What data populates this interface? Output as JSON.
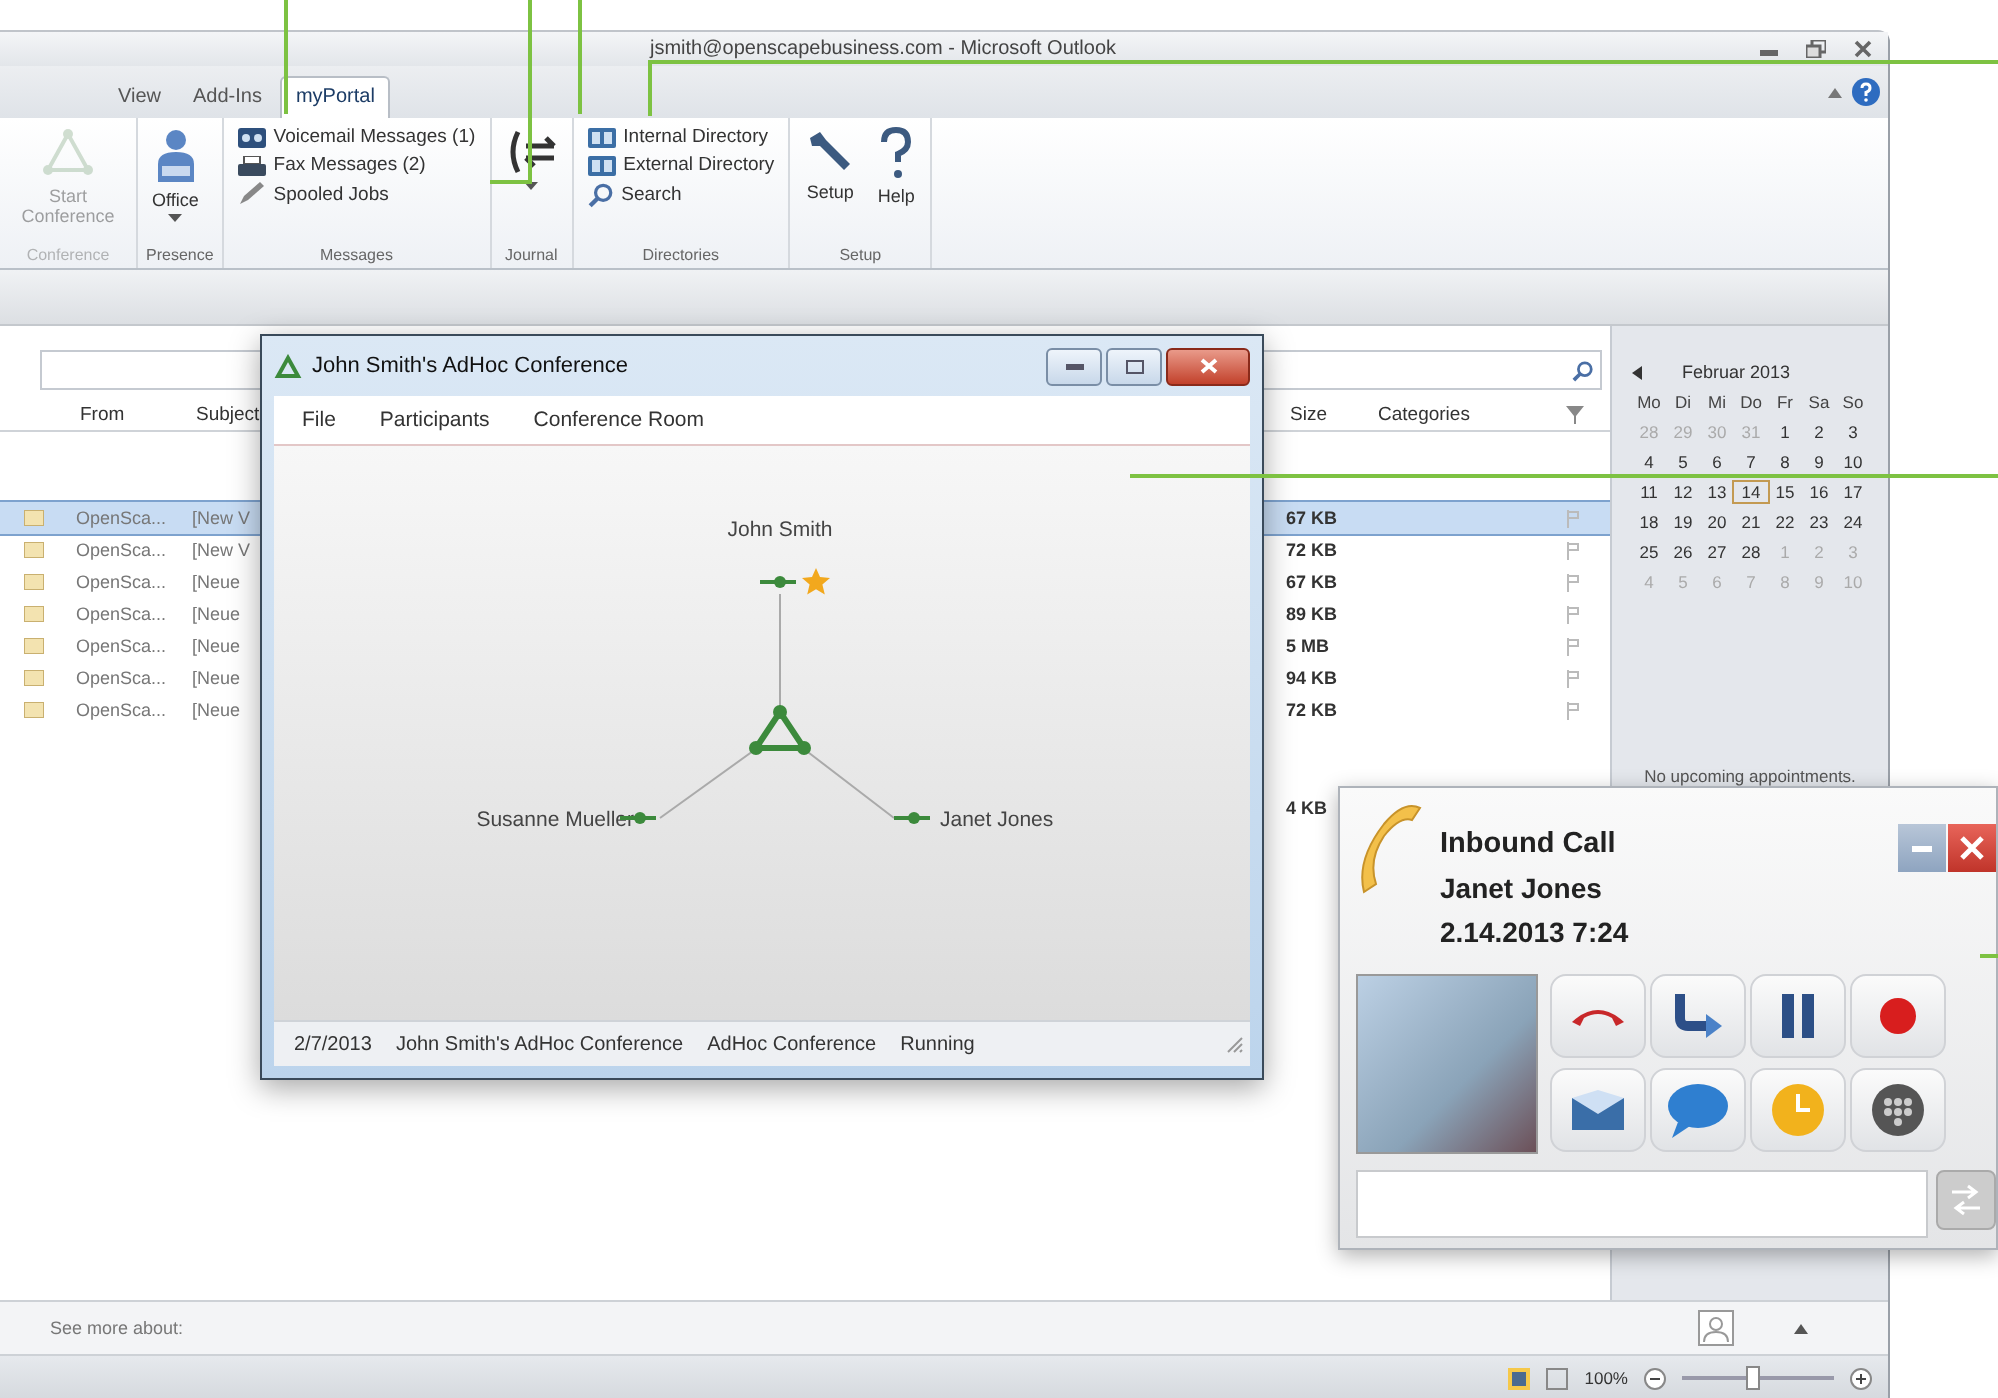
{
  "outlook": {
    "title": "jsmith@openscapebusiness.com - Microsoft Outlook",
    "tabs": [
      {
        "label": "View",
        "selected": false
      },
      {
        "label": "Add-Ins",
        "selected": false
      },
      {
        "label": "myPortal",
        "selected": true
      }
    ],
    "ribbon_groups": [
      {
        "label": "Conference",
        "disabled": true,
        "items": [
          {
            "kind": "large",
            "label": "Start Conference",
            "disabled": true,
            "dropdown": false
          }
        ]
      },
      {
        "label": "Presence",
        "disabled": false,
        "items": [
          {
            "kind": "large",
            "label": "Office",
            "disabled": false,
            "dropdown": true
          }
        ]
      },
      {
        "label": "Messages",
        "disabled": false,
        "items": [
          {
            "kind": "small",
            "label": "Voicemail Messages (1)",
            "disabled": false,
            "dropdown": false
          },
          {
            "kind": "small",
            "label": "Fax Messages (2)",
            "disabled": false,
            "dropdown": false
          },
          {
            "kind": "small",
            "label": "Spooled Jobs",
            "disabled": false,
            "dropdown": false
          }
        ]
      },
      {
        "label": "Journal",
        "disabled": false,
        "items": [
          {
            "kind": "large",
            "disabled": false,
            "dropdown": true
          }
        ]
      },
      {
        "label": "Directories",
        "disabled": false,
        "items": [
          {
            "kind": "small",
            "label": "Internal Directory",
            "disabled": false,
            "dropdown": false
          },
          {
            "kind": "small",
            "label": "External Directory",
            "disabled": false,
            "dropdown": false
          },
          {
            "kind": "small",
            "label": "Search",
            "disabled": false,
            "dropdown": false
          }
        ]
      },
      {
        "label": "Setup",
        "disabled": false,
        "items": [
          {
            "kind": "large",
            "label": "Setup",
            "disabled": false,
            "dropdown": false
          },
          {
            "kind": "large",
            "label": "Help",
            "disabled": false,
            "dropdown": false
          }
        ]
      }
    ],
    "mail": {
      "columns": [
        {
          "label": "From"
        },
        {
          "label": "Subject"
        },
        {
          "label": "Size"
        },
        {
          "label": "Categories"
        }
      ],
      "rows": [
        {
          "from": "OpenSca...",
          "subject": "[New V",
          "size": "67 KB",
          "selected": true
        },
        {
          "from": "OpenSca...",
          "subject": "[New V",
          "size": "72 KB",
          "selected": false
        },
        {
          "from": "OpenSca...",
          "subject": "[Neue",
          "size": "67 KB",
          "selected": false
        },
        {
          "from": "OpenSca...",
          "subject": "[Neue",
          "size": "89 KB",
          "selected": false
        },
        {
          "from": "OpenSca...",
          "subject": "[Neue",
          "size": "5 MB",
          "selected": false
        },
        {
          "from": "OpenSca...",
          "subject": "[Neue",
          "size": "94 KB",
          "selected": false
        },
        {
          "from": "OpenSca...",
          "subject": "[Neue",
          "size": "72 KB",
          "selected": false
        }
      ],
      "older_rows": [
        {
          "size": "4 KB",
          "selected": false
        }
      ]
    },
    "calendar": {
      "month": "Februar 2013",
      "weekdays": [
        "Mo",
        "Di",
        "Mi",
        "Do",
        "Fr",
        "Sa",
        "So"
      ],
      "days": [
        {
          "day": "28",
          "dim": true,
          "today": false
        },
        {
          "day": "29",
          "dim": true,
          "today": false
        },
        {
          "day": "30",
          "dim": true,
          "today": false
        },
        {
          "day": "31",
          "dim": true,
          "today": false
        },
        {
          "day": "1",
          "dim": false,
          "today": false
        },
        {
          "day": "2",
          "dim": false,
          "today": false
        },
        {
          "day": "3",
          "dim": false,
          "today": false
        },
        {
          "day": "4",
          "dim": false,
          "today": false
        },
        {
          "day": "5",
          "dim": false,
          "today": false
        },
        {
          "day": "6",
          "dim": false,
          "today": false
        },
        {
          "day": "7",
          "dim": false,
          "today": false
        },
        {
          "day": "8",
          "dim": false,
          "today": false
        },
        {
          "day": "9",
          "dim": false,
          "today": false
        },
        {
          "day": "10",
          "dim": false,
          "today": false
        },
        {
          "day": "11",
          "dim": false,
          "today": false
        },
        {
          "day": "12",
          "dim": false,
          "today": false
        },
        {
          "day": "13",
          "dim": false,
          "today": false
        },
        {
          "day": "14",
          "dim": false,
          "today": true
        },
        {
          "day": "15",
          "dim": false,
          "today": false
        },
        {
          "day": "16",
          "dim": false,
          "today": false
        },
        {
          "day": "17",
          "dim": false,
          "today": false
        },
        {
          "day": "18",
          "dim": false,
          "today": false
        },
        {
          "day": "19",
          "dim": false,
          "today": false
        },
        {
          "day": "20",
          "dim": false,
          "today": false
        },
        {
          "day": "21",
          "dim": false,
          "today": false
        },
        {
          "day": "22",
          "dim": false,
          "today": false
        },
        {
          "day": "23",
          "dim": false,
          "today": false
        },
        {
          "day": "24",
          "dim": false,
          "today": false
        },
        {
          "day": "25",
          "dim": false,
          "today": false
        },
        {
          "day": "26",
          "dim": false,
          "today": false
        },
        {
          "day": "27",
          "dim": false,
          "today": false
        },
        {
          "day": "28",
          "dim": false,
          "today": false
        },
        {
          "day": "1",
          "dim": true,
          "today": false
        },
        {
          "day": "2",
          "dim": true,
          "today": false
        },
        {
          "day": "3",
          "dim": true,
          "today": false
        },
        {
          "day": "4",
          "dim": true,
          "today": false
        },
        {
          "day": "5",
          "dim": true,
          "today": false
        },
        {
          "day": "6",
          "dim": true,
          "today": false
        },
        {
          "day": "7",
          "dim": true,
          "today": false
        },
        {
          "day": "8",
          "dim": true,
          "today": false
        },
        {
          "day": "9",
          "dim": true,
          "today": false
        },
        {
          "day": "10",
          "dim": true,
          "today": false
        }
      ],
      "note": "No upcoming appointments."
    },
    "people_pane": {
      "label": "See more about:"
    },
    "status_bar": {
      "zoom": "100%",
      "zoom_level": {
        "level": 0.45
      }
    }
  },
  "conference": {
    "title": "John Smith's AdHoc Conference",
    "menu": [
      "File",
      "Participants",
      "Conference Room"
    ],
    "participants": [
      {
        "name": "John Smith",
        "moderator": true
      },
      {
        "name": "Susanne Mueller",
        "moderator": false
      },
      {
        "name": "Janet Jones",
        "moderator": false
      }
    ],
    "status_bar": [
      "2/7/2013",
      "John Smith's AdHoc Conference",
      "AdHoc Conference",
      "Running"
    ]
  },
  "call": {
    "title": "Inbound Call",
    "caller": "Janet Jones",
    "time": "2.14.2013 7:24",
    "actions": [
      {
        "kind": "hangup"
      },
      {
        "kind": "forward"
      },
      {
        "kind": "hold"
      },
      {
        "kind": "record"
      },
      {
        "kind": "mail"
      },
      {
        "kind": "chat"
      },
      {
        "kind": "clock"
      },
      {
        "kind": "dialpad"
      }
    ]
  }
}
